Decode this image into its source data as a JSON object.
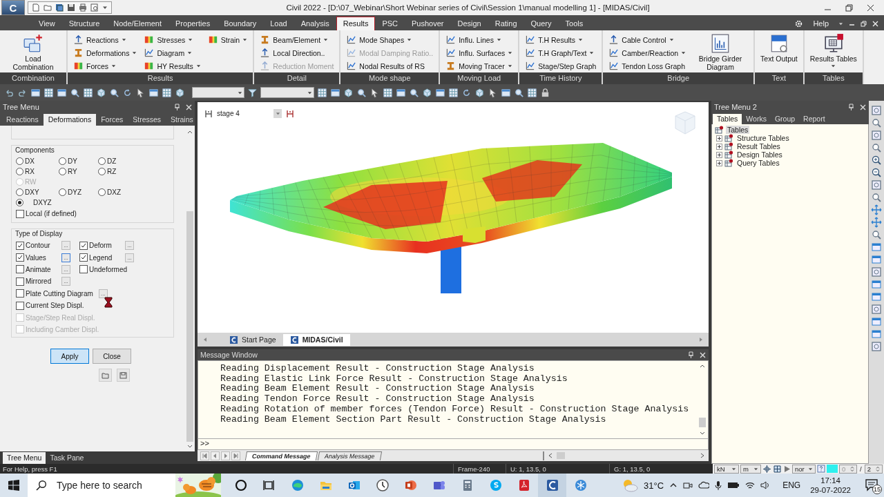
{
  "window": {
    "logo": "C",
    "title": "Civil 2022 - [D:\\07_Webinar\\Short Webinar series of Civil\\Session 1\\manual modelling 1] - [MIDAS/Civil]"
  },
  "menu_tabs": [
    {
      "label": "View",
      "selected": false
    },
    {
      "label": "Structure",
      "selected": false
    },
    {
      "label": "Node/Element",
      "selected": false
    },
    {
      "label": "Properties",
      "selected": false
    },
    {
      "label": "Boundary",
      "selected": false
    },
    {
      "label": "Load",
      "selected": false
    },
    {
      "label": "Analysis",
      "selected": false
    },
    {
      "label": "Results",
      "selected": true
    },
    {
      "label": "PSC",
      "selected": false
    },
    {
      "label": "Pushover",
      "selected": false
    },
    {
      "label": "Design",
      "selected": false
    },
    {
      "label": "Rating",
      "selected": false
    },
    {
      "label": "Query",
      "selected": false
    },
    {
      "label": "Tools",
      "selected": false
    }
  ],
  "help": "Help",
  "ribbon": [
    {
      "label": "Combination",
      "items": [
        {
          "label": "Load Combination",
          "kind": "large",
          "menu": false,
          "disabled": false
        }
      ]
    },
    {
      "label": "Results",
      "items": [
        {
          "label": "Reactions",
          "kind": "small",
          "menu": true,
          "disabled": false
        },
        {
          "label": "Deformations",
          "kind": "small",
          "menu": true,
          "disabled": false
        },
        {
          "label": "Forces",
          "kind": "small",
          "menu": true,
          "disabled": false
        },
        {
          "label": "Stresses",
          "kind": "small",
          "menu": true,
          "disabled": false
        },
        {
          "label": "Diagram",
          "kind": "small",
          "menu": true,
          "disabled": false
        },
        {
          "label": "HY Results",
          "kind": "small",
          "menu": true,
          "disabled": false
        },
        {
          "label": "Strain",
          "kind": "small",
          "menu": true,
          "disabled": false
        }
      ]
    },
    {
      "label": "Detail",
      "items": [
        {
          "label": "Beam/Element",
          "kind": "small",
          "menu": true,
          "disabled": false
        },
        {
          "label": "Local Direction..",
          "kind": "small",
          "menu": false,
          "disabled": false
        },
        {
          "label": "Reduction Moment",
          "kind": "small",
          "menu": false,
          "disabled": true
        }
      ]
    },
    {
      "label": "Mode shape",
      "items": [
        {
          "label": "Mode Shapes",
          "kind": "small",
          "menu": true,
          "disabled": false
        },
        {
          "label": "Modal Damping Ratio..",
          "kind": "small",
          "menu": false,
          "disabled": true
        },
        {
          "label": "Nodal Results of RS",
          "kind": "small",
          "menu": false,
          "disabled": false
        }
      ]
    },
    {
      "label": "Moving Load",
      "items": [
        {
          "label": "Influ. Lines",
          "kind": "small",
          "menu": true,
          "disabled": false
        },
        {
          "label": "Influ. Surfaces",
          "kind": "small",
          "menu": true,
          "disabled": false
        },
        {
          "label": "Moving Tracer",
          "kind": "small",
          "menu": true,
          "disabled": false
        }
      ]
    },
    {
      "label": "Time History",
      "items": [
        {
          "label": "T.H Results",
          "kind": "small",
          "menu": true,
          "disabled": false
        },
        {
          "label": "T.H Graph/Text",
          "kind": "small",
          "menu": true,
          "disabled": false
        },
        {
          "label": "Stage/Step Graph",
          "kind": "small",
          "menu": false,
          "disabled": false
        }
      ]
    },
    {
      "label": "Bridge",
      "items": [
        {
          "label": "Cable Control",
          "kind": "small",
          "menu": true,
          "disabled": false
        },
        {
          "label": "Camber/Reaction",
          "kind": "small",
          "menu": true,
          "disabled": false
        },
        {
          "label": "Tendon Loss Graph",
          "kind": "small",
          "menu": false,
          "disabled": false
        },
        {
          "label": "Bridge Girder Diagram",
          "kind": "large",
          "menu": false,
          "disabled": false
        }
      ]
    },
    {
      "label": "Text",
      "items": [
        {
          "label": "Text Output",
          "kind": "large",
          "menu": false,
          "disabled": false
        }
      ]
    },
    {
      "label": "Tables",
      "items": [
        {
          "label": "Results Tables",
          "kind": "large",
          "menu": true,
          "disabled": false
        }
      ]
    }
  ],
  "tree_menu": {
    "title": "Tree Menu",
    "tabs": [
      {
        "label": "Reactions",
        "selected": false
      },
      {
        "label": "Deformations",
        "selected": true
      },
      {
        "label": "Forces",
        "selected": false
      },
      {
        "label": "Stresses",
        "selected": false
      },
      {
        "label": "Strains",
        "selected": false
      }
    ],
    "components": {
      "title": "Components",
      "rows": [
        [
          {
            "label": "DX",
            "selected": false,
            "disabled": false
          },
          {
            "label": "DY",
            "selected": false,
            "disabled": false
          },
          {
            "label": "DZ",
            "selected": false,
            "disabled": false
          }
        ],
        [
          {
            "label": "RX",
            "selected": false,
            "disabled": false
          },
          {
            "label": "RY",
            "selected": false,
            "disabled": false
          },
          {
            "label": "RZ",
            "selected": false,
            "disabled": false
          }
        ],
        [
          {
            "label": "RW",
            "selected": false,
            "disabled": true
          }
        ],
        [
          {
            "label": "DXY",
            "selected": false,
            "disabled": false
          },
          {
            "label": "DYZ",
            "selected": false,
            "disabled": false
          },
          {
            "label": "DXZ",
            "selected": false,
            "disabled": false
          }
        ],
        [
          {
            "label": "DXYZ",
            "selected": true,
            "disabled": false
          }
        ]
      ]
    },
    "local": {
      "label": "Local (if defined)",
      "checked": false
    },
    "display": {
      "title": "Type of Display",
      "rows": [
        [
          {
            "label": "Contour",
            "checked": true,
            "disabled": false,
            "more": "...",
            "focused": false
          },
          {
            "label": "Deform",
            "checked": true,
            "disabled": false,
            "more": "...",
            "focused": false
          }
        ],
        [
          {
            "label": "Values",
            "checked": true,
            "disabled": false,
            "more": "...",
            "focused": true
          },
          {
            "label": "Legend",
            "checked": true,
            "disabled": false,
            "more": "...",
            "focused": false
          }
        ],
        [
          {
            "label": "Animate",
            "checked": false,
            "disabled": false,
            "more": "...",
            "focused": false
          },
          {
            "label": "Undeformed",
            "checked": false,
            "disabled": false
          }
        ],
        [
          {
            "label": "Mirrored",
            "checked": false,
            "disabled": false,
            "more": "...",
            "focused": false
          }
        ],
        [
          {
            "label": "Plate Cutting Diagram",
            "checked": false,
            "disabled": false,
            "more": "...",
            "focused": false
          }
        ],
        [
          {
            "label": "Current Step Displ.",
            "checked": false,
            "disabled": false
          }
        ],
        [
          {
            "label": "Stage/Step Real Displ.",
            "checked": false,
            "disabled": true
          }
        ],
        [
          {
            "label": "Including Camber Displ.",
            "checked": false,
            "disabled": true
          }
        ]
      ]
    },
    "buttons": [
      {
        "label": "Apply",
        "default": true
      },
      {
        "label": "Close",
        "default": false
      }
    ]
  },
  "dock_tabs": [
    {
      "label": "Tree Menu",
      "selected": true
    },
    {
      "label": "Task Pane",
      "selected": false
    }
  ],
  "viewport": {
    "stage": "stage 4"
  },
  "doc_tabs": [
    {
      "label": "Start Page",
      "selected": false
    },
    {
      "label": "MIDAS/Civil",
      "selected": true
    }
  ],
  "message_window": {
    "title": "Message Window",
    "lines": [
      "Reading Displacement Result - Construction Stage Analysis",
      "Reading Elastic Link Force Result - Construction Stage Analysis",
      "Reading Beam Element Result - Construction Stage Analysis",
      "Reading Tendon Force Result - Construction Stage Analysis",
      "Reading Rotation of member forces (Tendon Force) Result - Construction Stage Analysis",
      "Reading Beam Element Section Part Result - Construction Stage Analysis"
    ],
    "prompt": ">>",
    "tabs": [
      {
        "label": "Command Message",
        "selected": true
      },
      {
        "label": "Analysis Message",
        "selected": false
      }
    ]
  },
  "tree_menu_2": {
    "title": "Tree Menu 2",
    "tabs": [
      {
        "label": "Tables",
        "selected": true
      },
      {
        "label": "Works",
        "selected": false
      },
      {
        "label": "Group",
        "selected": false
      },
      {
        "label": "Report",
        "selected": false
      }
    ],
    "tree": [
      {
        "label": "Tables",
        "selected": true,
        "children": [
          {
            "label": "Structure Tables",
            "selected": false,
            "expanded": false
          },
          {
            "label": "Result Tables",
            "selected": false,
            "expanded": false
          },
          {
            "label": "Design Tables",
            "selected": false,
            "expanded": false
          },
          {
            "label": "Query Tables",
            "selected": false,
            "expanded": false
          }
        ]
      }
    ]
  },
  "status_bar": {
    "help": "For Help, press F1",
    "frame": "Frame-240",
    "u_coords": "U: 1, 13.5, 0",
    "g_coords": "G: 1, 13.5, 0",
    "force_unit": "kN",
    "length_unit": "m",
    "mode": "nor",
    "step": "0",
    "separator": "/",
    "total": "2"
  },
  "taskbar": {
    "search_placeholder": "Type here to search",
    "temperature": "31°C",
    "language": "ENG",
    "time": "17:14",
    "date": "29-07-2022",
    "notifications": "15"
  }
}
